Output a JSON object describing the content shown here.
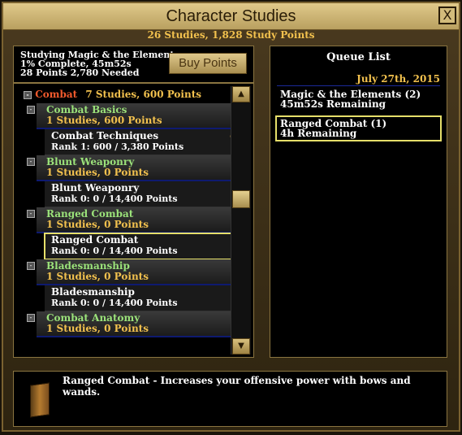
{
  "window": {
    "title": "Character Studies",
    "subtitle": "26 Studies, 1,828 Study Points",
    "close_label": "X"
  },
  "status": {
    "line1": "Studying Magic & the Elements",
    "line2": "1% Complete, 45m52s",
    "line3": "28 Points 2,780 Needed",
    "buy_label": "Buy Points"
  },
  "tree": {
    "category": {
      "toggle": "-",
      "name": "Combat",
      "stats": "7 Studies, 600 Points"
    },
    "groups": [
      {
        "name": "Combat Basics",
        "stats": "1 Studies, 600 Points",
        "item": {
          "name": "Combat Techniques",
          "rank": "Rank 1: 600 / 3,380 Points"
        }
      },
      {
        "name": "Blunt Weaponry",
        "stats": "1 Studies, 0 Points",
        "item": {
          "name": "Blunt Weaponry",
          "rank": "Rank 0: 0 / 14,400 Points"
        }
      },
      {
        "name": "Ranged Combat",
        "stats": "1 Studies, 0 Points",
        "item": {
          "name": "Ranged Combat",
          "rank": "Rank 0: 0 / 14,400 Points"
        }
      },
      {
        "name": "Bladesmanship",
        "stats": "1 Studies, 0 Points",
        "item": {
          "name": "Bladesmanship",
          "rank": "Rank 0: 0 / 14,400 Points"
        }
      },
      {
        "name": "Combat Anatomy",
        "stats": "1 Studies, 0 Points"
      }
    ]
  },
  "queue": {
    "title": "Queue List",
    "date": "July 27th, 2015",
    "items": [
      {
        "line1": "Magic & the Elements (2)",
        "line2": "45m52s Remaining"
      },
      {
        "line1": "Ranged Combat (1)",
        "line2": "4h Remaining"
      }
    ]
  },
  "description": "Ranged Combat - Increases your offensive power with bows and wands.",
  "icons": {
    "close": "close-icon",
    "scroll_up": "arrow-up-icon",
    "scroll_down": "arrow-down-icon",
    "pin": "pin-icon",
    "book": "book-icon"
  },
  "colors": {
    "accent_gold": "#f2c14e",
    "category_red": "#f25a2d",
    "group_green": "#9be27a",
    "selection": "#e6df6a"
  }
}
